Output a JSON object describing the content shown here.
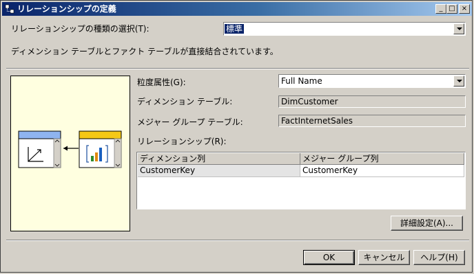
{
  "window": {
    "title": "リレーションシップの定義",
    "controls": {
      "minimize": "_",
      "maximize": "□",
      "close": "×"
    }
  },
  "relationship_type": {
    "label": "リレーションシップの種類の選択(T):",
    "value": "標準"
  },
  "description": "ディメンション テーブルとファクト テーブルが直接結合されています。",
  "granularity": {
    "label": "粒度属性(G):",
    "value": "Full Name"
  },
  "dimension_table": {
    "label": "ディメンション テーブル:",
    "value": "DimCustomer"
  },
  "measure_group_table": {
    "label": "メジャー グループ テーブル:",
    "value": "FactInternetSales"
  },
  "relationship": {
    "label": "リレーションシップ(R):",
    "columns": [
      "ディメンション列",
      "メジャー グループ列"
    ],
    "rows": [
      [
        "CustomerKey",
        "CustomerKey"
      ]
    ]
  },
  "buttons": {
    "advanced": "詳細設定(A)...",
    "ok": "OK",
    "cancel": "キャンセル",
    "help": "ヘルプ(H)"
  },
  "diagram": {
    "dimension_header_color": "#8fb4f0",
    "fact_header_color": "#f5c816",
    "background_color": "#ffffe0"
  }
}
